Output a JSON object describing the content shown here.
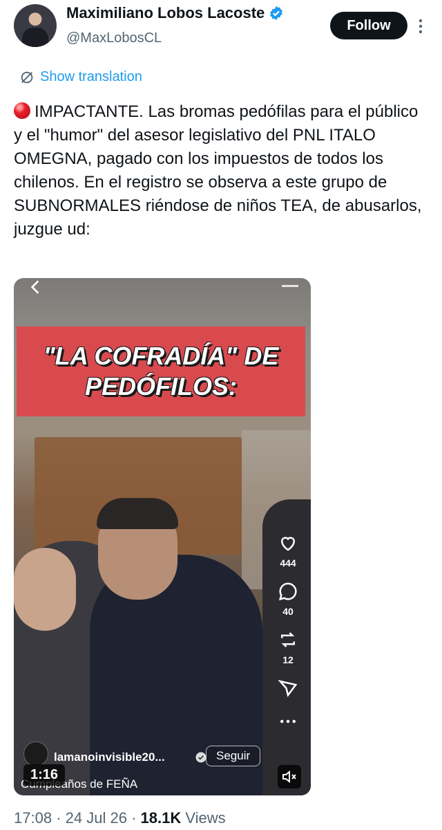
{
  "author": {
    "name": "Maximiliano Lobos Lacoste",
    "handle": "@MaxLobosCL"
  },
  "header": {
    "follow_label": "Follow"
  },
  "translate": {
    "label": "Show translation"
  },
  "tweet": {
    "text": "IMPACTANTE. Las bromas pedófilas para el público y el \"humor\" del asesor legislativo del PNL ITALO OMEGNA, pagado con los impuestos de todos los chilenos. En el registro se observa a este grupo de SUBNORMALES riéndose de niños TEA, de abusarlos, juzgue ud:"
  },
  "video": {
    "banner_line1": "\"LA COFRADÍA\" DE",
    "banner_line2": "PEDÓFILOS:",
    "likes": "444",
    "comments": "40",
    "reposts": "12",
    "account": "lamanoinvisible20...",
    "follow_label": "Seguir",
    "caption": "Cumpleaños de FEÑA",
    "duration": "1:16"
  },
  "meta": {
    "time": "17:08",
    "date": "24 Jul 26",
    "views_count": "18.1K",
    "views_label": "Views"
  },
  "colors": {
    "accent": "#1d9bf0",
    "text": "#0f1419",
    "muted": "#536471",
    "banner": "#d94a4f"
  }
}
